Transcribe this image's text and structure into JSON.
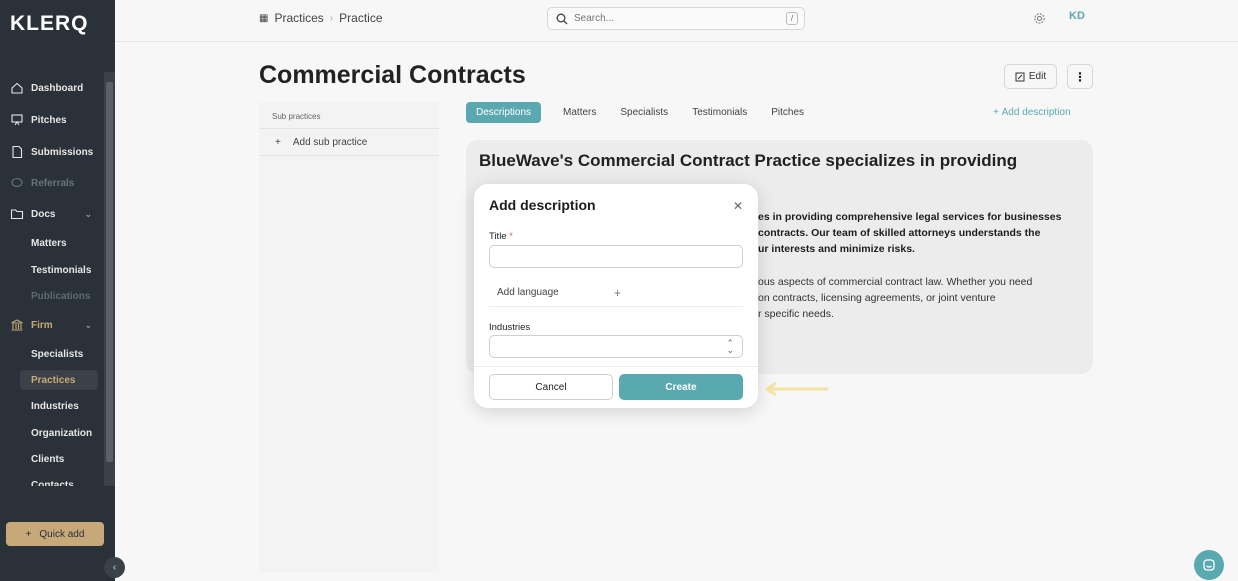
{
  "app": {
    "logo": "KLERQ"
  },
  "sidebar": {
    "items": [
      {
        "label": "Dashboard",
        "icon": "home-icon"
      },
      {
        "label": "Pitches",
        "icon": "presentation-icon"
      },
      {
        "label": "Submissions",
        "icon": "document-icon"
      },
      {
        "label": "Referrals",
        "icon": "chat-icon"
      },
      {
        "label": "Docs",
        "icon": "folder-icon"
      }
    ],
    "docs_sub": [
      "Matters",
      "Testimonials",
      "Publications"
    ],
    "firm": {
      "label": "Firm",
      "icon": "bank-icon"
    },
    "firm_sub": [
      "Specialists",
      "Practices",
      "Industries",
      "Organization",
      "Clients",
      "Contacts"
    ],
    "quick_add": "Quick add"
  },
  "topbar": {
    "breadcrumb": [
      "Practices",
      "Practice"
    ],
    "search_placeholder": "Search...",
    "search_shortcut": "/",
    "avatar": "KD"
  },
  "main": {
    "title": "Commercial Contracts",
    "edit_label": "Edit",
    "more_label": "⋮",
    "sub_practices_header": "Sub practices",
    "add_sub_practice": "Add sub practice",
    "tabs": [
      "Descriptions",
      "Matters",
      "Specialists",
      "Testimonials",
      "Pitches"
    ],
    "active_tab": "Descriptions",
    "add_description": "Add description",
    "description_title": "BlueWave's Commercial Contract Practice specializes in providing",
    "description_bold_lines": [
      "es in providing comprehensive legal services for businesses",
      "contracts. Our team of skilled attorneys understands the",
      "ur interests and minimize risks."
    ],
    "description_body_lines": [
      "ous aspects of commercial contract law. Whether you need",
      "on contracts, licensing agreements, or joint venture",
      "r specific needs."
    ]
  },
  "modal": {
    "title": "Add description",
    "title_label": "Title",
    "required_mark": "*",
    "title_value": "",
    "add_language": "Add language",
    "industries_label": "Industries",
    "industries_value": "",
    "cancel": "Cancel",
    "create": "Create"
  },
  "colors": {
    "accent": "#5aa9b0",
    "sidebar": "#2b3138",
    "gold": "#c7a979",
    "arrow": "#f3e3a1"
  }
}
